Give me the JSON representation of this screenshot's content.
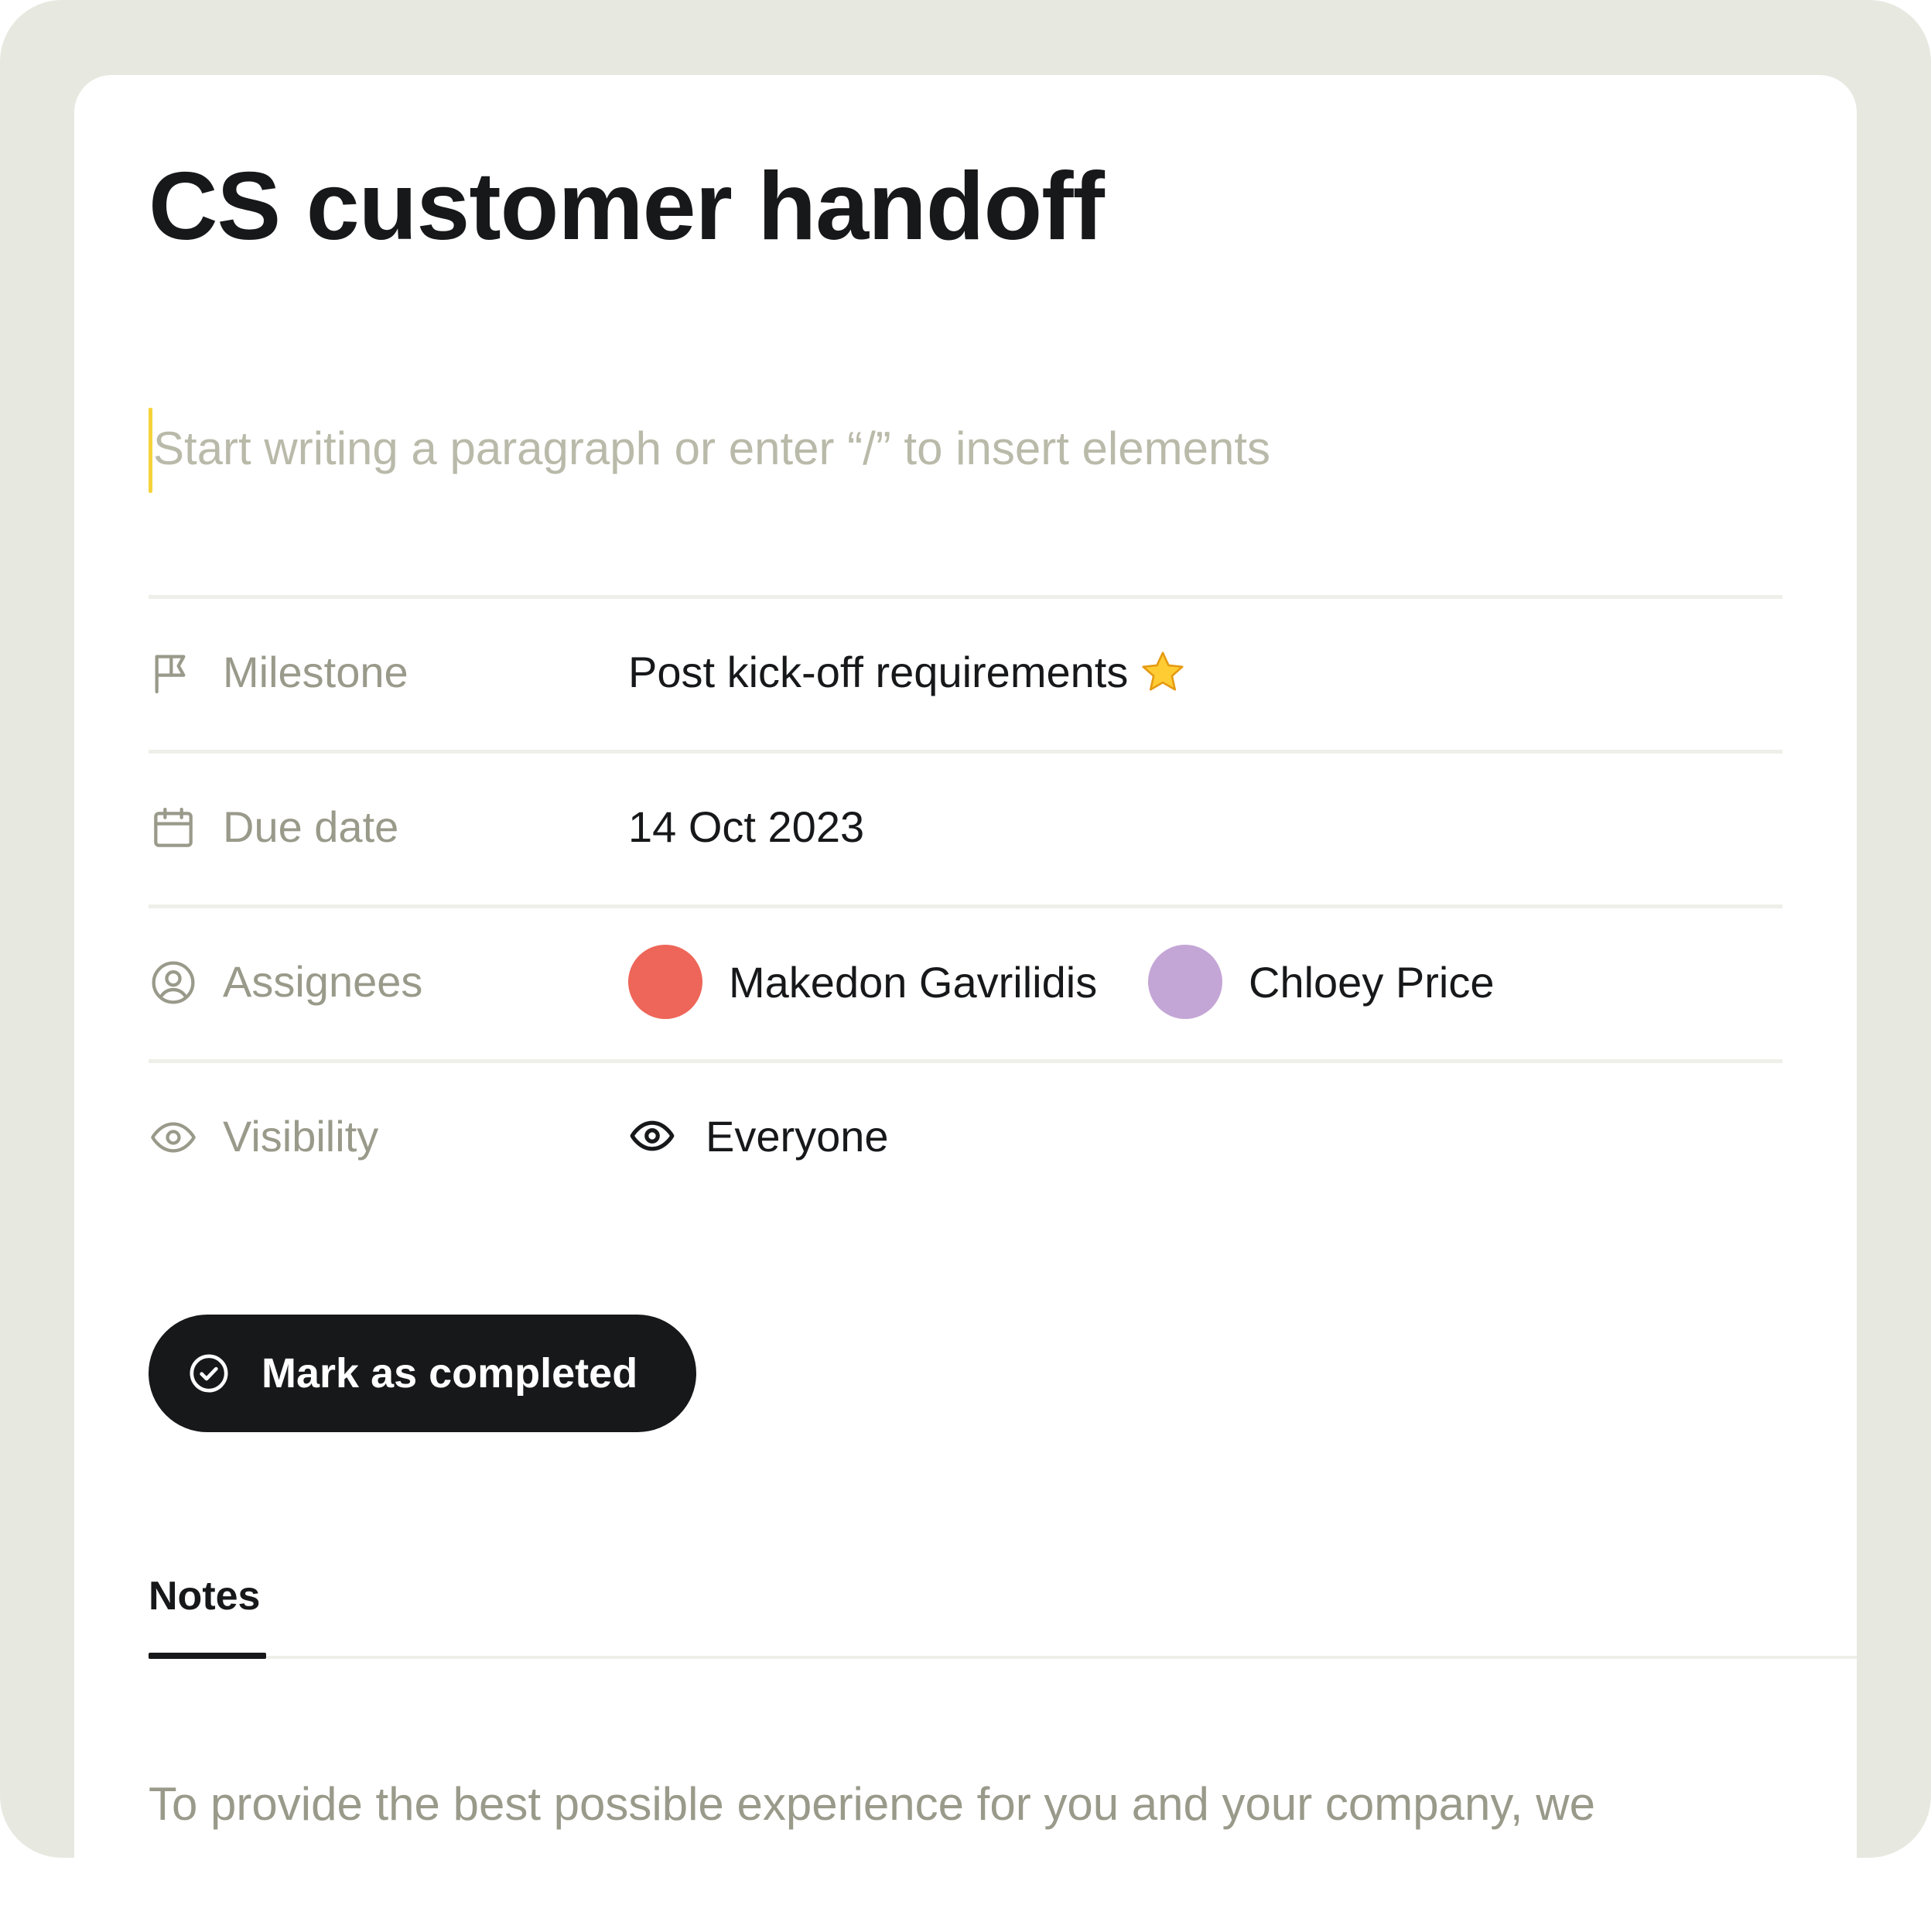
{
  "task": {
    "title": "CS customer handoff",
    "editor_placeholder": "Start writing a paragraph or enter “/” to insert elements"
  },
  "properties": {
    "milestone": {
      "label": "Milestone",
      "value": "Post kick-off requirements",
      "icon": "flag-icon"
    },
    "due_date": {
      "label": "Due date",
      "value": "14 Oct 2023",
      "icon": "calendar-icon"
    },
    "assignees": {
      "label": "Assignees",
      "icon": "user-circle-icon",
      "people": [
        {
          "name": "Makedon Gavrilidis",
          "color": "#ee6659"
        },
        {
          "name": "Chloey Price",
          "color": "#c4a6d6"
        }
      ]
    },
    "visibility": {
      "label": "Visibility",
      "value": "Everyone",
      "icon": "eye-icon"
    }
  },
  "actions": {
    "complete_label": "Mark as completed",
    "complete_icon": "check-circle-icon"
  },
  "tabs": [
    {
      "label": "Notes",
      "active": true
    }
  ],
  "notes": {
    "text": "To provide the best possible experience for you and your company, we"
  },
  "colors": {
    "frame": "#e7e8e0",
    "primary_text": "#17181a",
    "muted_text": "#9a9a8b",
    "placeholder": "#b9baa9",
    "caret": "#f5d33a",
    "divider": "#efefe9"
  }
}
